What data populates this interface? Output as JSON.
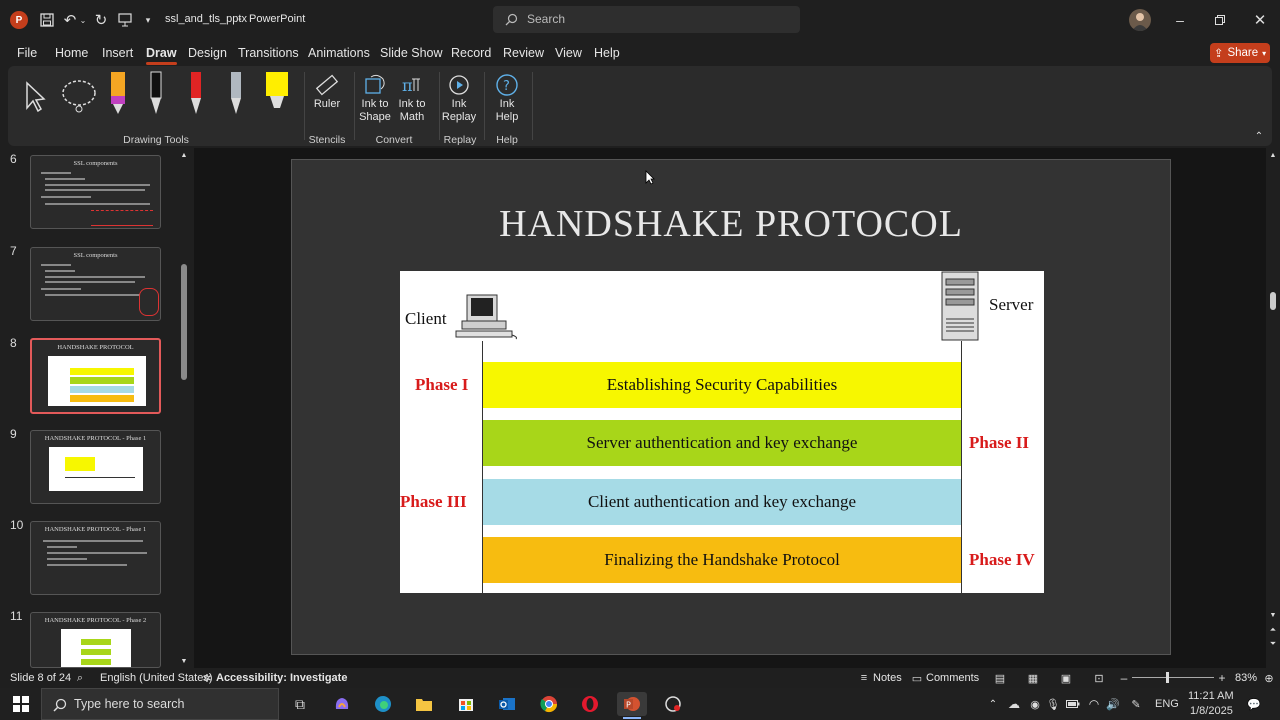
{
  "app": {
    "file_name": "ssl_and_tls_pptx",
    "app_name": "PowerPoint",
    "search_placeholder": "Search",
    "share_label": "Share"
  },
  "tabs": [
    {
      "label": "File"
    },
    {
      "label": "Home"
    },
    {
      "label": "Insert"
    },
    {
      "label": "Draw"
    },
    {
      "label": "Design"
    },
    {
      "label": "Transitions"
    },
    {
      "label": "Animations"
    },
    {
      "label": "Slide Show"
    },
    {
      "label": "Record"
    },
    {
      "label": "Review"
    },
    {
      "label": "View"
    },
    {
      "label": "Help"
    }
  ],
  "ribbon": {
    "groups": {
      "drawing_tools": "Drawing Tools",
      "stencils": "Stencils",
      "convert": "Convert",
      "replay": "Replay",
      "help": "Help"
    },
    "buttons": {
      "ruler": "Ruler",
      "ink_to_shape": [
        "Ink to",
        "Shape"
      ],
      "ink_to_math": [
        "Ink to",
        "Math"
      ],
      "ink_replay": [
        "Ink",
        "Replay"
      ],
      "ink_help": [
        "Ink",
        "Help"
      ]
    },
    "pen_colors": [
      "#f5a623",
      "#ffffff",
      "#e02424",
      "#b0b8c0",
      "#ffee00"
    ]
  },
  "thumbnails": [
    {
      "num": "6",
      "title": "SSL components"
    },
    {
      "num": "7",
      "title": "SSL components"
    },
    {
      "num": "8",
      "title": "HANDSHAKE PROTOCOL"
    },
    {
      "num": "9",
      "title": "HANDSHAKE PROTOCOL - Phase 1"
    },
    {
      "num": "10",
      "title": "HANDSHAKE PROTOCOL - Phase 1"
    },
    {
      "num": "11",
      "title": "HANDSHAKE PROTOCOL - Phase 2"
    }
  ],
  "slide": {
    "title": "HANDSHAKE PROTOCOL",
    "client_label": "Client",
    "server_label": "Server",
    "phases": [
      {
        "label": "Phase I",
        "text": "Establishing Security Capabilities",
        "color": "#f7f700"
      },
      {
        "label": "Phase II",
        "text": "Server authentication and key exchange",
        "color": "#a8d619"
      },
      {
        "label": "Phase III",
        "text": "Client authentication and key exchange",
        "color": "#a6dbe6"
      },
      {
        "label": "Phase IV",
        "text": "Finalizing the Handshake Protocol",
        "color": "#f7bc10"
      }
    ]
  },
  "status": {
    "slide_info": "Slide 8 of 24",
    "language": "English (United States)",
    "accessibility": "Accessibility: Investigate",
    "notes": "Notes",
    "comments": "Comments",
    "zoom": "83%"
  },
  "taskbar": {
    "search_placeholder": "Type here to search",
    "lang": "ENG",
    "time": "11:21 AM",
    "date": "1/8/2025"
  }
}
